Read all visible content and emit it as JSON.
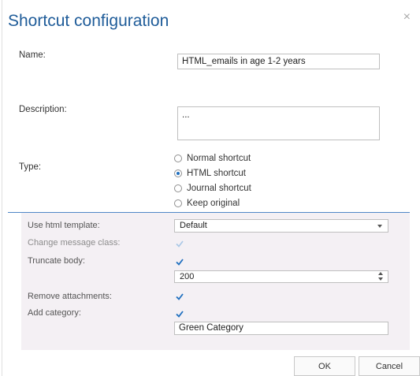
{
  "dialog": {
    "title": "Shortcut configuration",
    "close_glyph": "×"
  },
  "form": {
    "name_label": "Name:",
    "name_value": "HTML_emails in age 1-2 years",
    "description_label": "Description:",
    "description_value": "...",
    "type_label": "Type:",
    "type_options": [
      {
        "label": "Normal shortcut",
        "checked": false
      },
      {
        "label": "HTML shortcut",
        "checked": true
      },
      {
        "label": "Journal shortcut",
        "checked": false
      },
      {
        "label": "Keep original",
        "checked": false
      }
    ]
  },
  "html_options": {
    "use_template_label": "Use html template:",
    "template_value": "Default",
    "change_class_label": "Change message class:",
    "change_class_checked": true,
    "truncate_label": "Truncate body:",
    "truncate_checked": true,
    "truncate_value": "200",
    "remove_attachments_label": "Remove attachments:",
    "remove_attachments_checked": true,
    "add_category_label": "Add category:",
    "add_category_checked": true,
    "category_value": "Green Category"
  },
  "footer": {
    "ok_label": "OK",
    "cancel_label": "Cancel"
  },
  "colors": {
    "title": "#1f5c99",
    "accent_line": "#4f86c6",
    "panel_bg": "#f4f0f4",
    "check_active": "#1f6fbf",
    "check_disabled": "#a9c7e6"
  }
}
